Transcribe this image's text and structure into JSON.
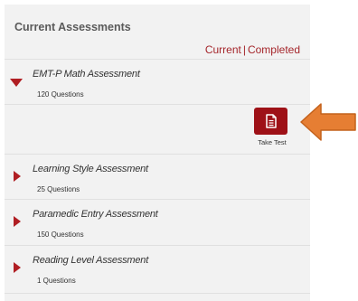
{
  "panel": {
    "title": "Current Assessments",
    "filters": {
      "current_label": "Current",
      "separator": "|",
      "completed_label": "Completed"
    }
  },
  "assessments": [
    {
      "title": "EMT-P Math Assessment",
      "count": "120 Questions",
      "expanded": true
    },
    {
      "title": "Learning Style Assessment",
      "count": "25 Questions",
      "expanded": false
    },
    {
      "title": "Paramedic Entry Assessment",
      "count": "150 Questions",
      "expanded": false
    },
    {
      "title": "Reading Level Assessment",
      "count": "1 Questions",
      "expanded": false
    }
  ],
  "take_test": {
    "label": "Take Test",
    "icon": "document-icon"
  },
  "colors": {
    "accent": "#a5262b",
    "button": "#9e1117",
    "arrow": "#e67e33",
    "panel_bg": "#f2f2f2"
  }
}
